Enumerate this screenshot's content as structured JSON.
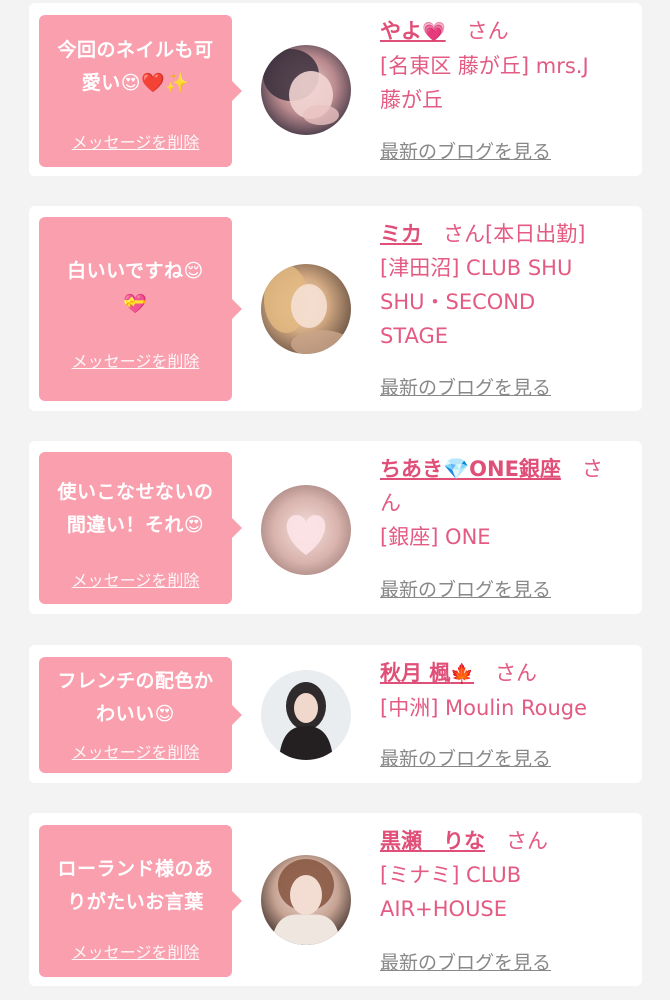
{
  "feed": {
    "cards": [
      {
        "message_lines": [
          "今回のネイルも可",
          "愛い😍❤️✨"
        ],
        "delete_label": "メッセージを削除",
        "name": "やよ",
        "name_emoji": "💗",
        "name_suffix": "さん",
        "shop_lines": [
          "[名東区 藤が丘] mrs.J",
          "藤が丘"
        ],
        "blog_label": "最新のブログを見る"
      },
      {
        "message_lines": [
          "白いいですね😌",
          "💝"
        ],
        "delete_label": "メッセージを削除",
        "name": "ミカ",
        "name_emoji": "",
        "name_suffix": "さん[本日出勤]",
        "shop_lines": [
          "[津田沼] CLUB SHU",
          "SHU・SECOND",
          "STAGE"
        ],
        "blog_label": "最新のブログを見る"
      },
      {
        "message_lines": [
          "使いこなせないの",
          "間違い！それ😍"
        ],
        "delete_label": "メッセージを削除",
        "name": "ちあき💎ONE銀座",
        "name_emoji": "",
        "name_suffix": "さ",
        "name_suffix_line2": "ん",
        "shop_lines": [
          "[銀座] ONE"
        ],
        "blog_label": "最新のブログを見る"
      },
      {
        "message_lines": [
          "フレンチの配色か",
          "わいい😍"
        ],
        "delete_label": "メッセージを削除",
        "name": "秋月 楓",
        "name_emoji": "🍁",
        "name_suffix": "さん",
        "shop_lines": [
          "[中洲] Moulin Rouge"
        ],
        "blog_label": "最新のブログを見る"
      },
      {
        "message_lines": [
          "ローランド様のあ",
          "りがたいお言葉"
        ],
        "delete_label": "メッセージを削除",
        "name": "黒瀬　りな",
        "name_emoji": "",
        "name_suffix": "さん",
        "shop_lines": [
          "[ミナミ] CLUB",
          "AIR+HOUSE"
        ],
        "blog_label": "最新のブログを見る"
      }
    ]
  },
  "colors": {
    "bubble": "#f99fae",
    "accent": "#e04f77",
    "background": "#f3f3f3",
    "link_gray": "#888888"
  }
}
